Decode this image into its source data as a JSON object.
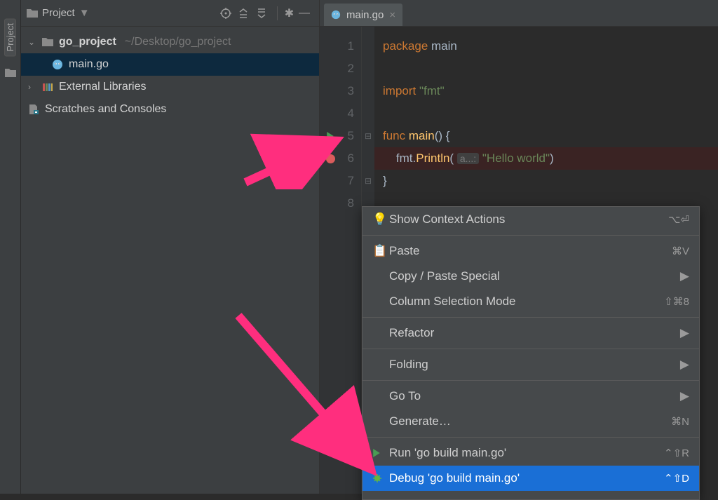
{
  "leftbar": {
    "label": "Project"
  },
  "project_header": {
    "title": "Project"
  },
  "tree": {
    "root": {
      "name": "go_project",
      "path": "~/Desktop/go_project"
    },
    "file": "main.go",
    "ext": "External Libraries",
    "scratch": "Scratches and Consoles"
  },
  "tab": {
    "name": "main.go"
  },
  "code": {
    "l1a": "package",
    "l1b": " main",
    "l3a": "import",
    "l3b": " \"fmt\"",
    "l5a": "func",
    "l5b": " main",
    "l5c": "() {",
    "l6a": "    fmt.",
    "l6b": "Println",
    "l6c": "( ",
    "l6hint": "a...:",
    "l6d": " \"Hello world\"",
    "l6e": ")",
    "l7": "}"
  },
  "lines": {
    "n1": "1",
    "n2": "2",
    "n3": "3",
    "n4": "4",
    "n5": "5",
    "n6": "6",
    "n7": "7",
    "n8": "8"
  },
  "menu": {
    "context": "Show Context Actions",
    "context_k": "⌥⏎",
    "paste": "Paste",
    "paste_k": "⌘V",
    "special": "Copy / Paste Special",
    "column": "Column Selection Mode",
    "column_k": "⇧⌘8",
    "refactor": "Refactor",
    "folding": "Folding",
    "goto": "Go To",
    "generate": "Generate…",
    "generate_k": "⌘N",
    "run": "Run 'go build main.go'",
    "run_k": "⌃⇧R",
    "debug": "Debug 'go build main.go'",
    "debug_k": "⌃⇧D"
  }
}
